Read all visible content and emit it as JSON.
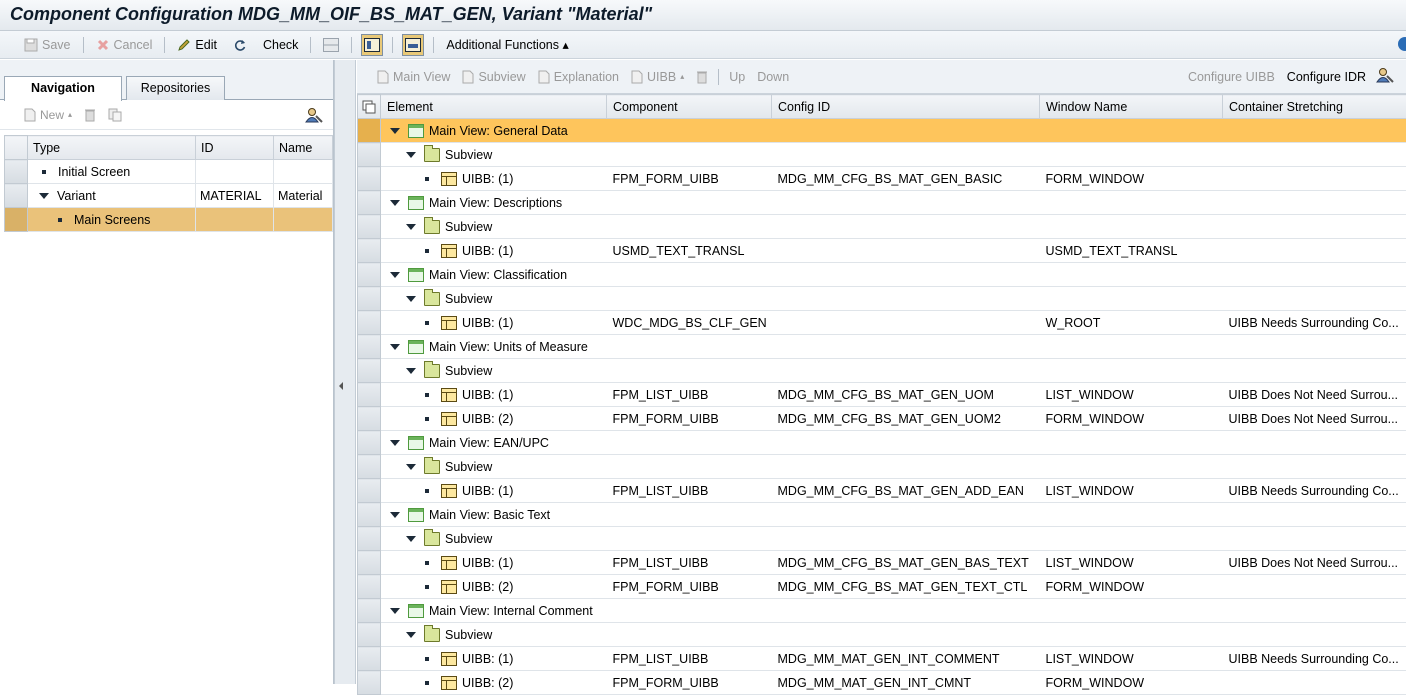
{
  "window": {
    "title": "Component Configuration MDG_MM_OIF_BS_MAT_GEN, Variant \"Material\""
  },
  "toolbar": {
    "save": "Save",
    "cancel": "Cancel",
    "edit": "Edit",
    "check": "Check",
    "additional_functions": "Additional Functions ▴"
  },
  "left": {
    "tabs": [
      "Navigation",
      "Repositories"
    ],
    "new_label": "New",
    "columns": [
      "Type",
      "ID",
      "Name"
    ],
    "rows": [
      {
        "type": "Initial Screen",
        "id": "",
        "name": ""
      },
      {
        "type": "Variant",
        "id": "MATERIAL",
        "name": "Material"
      },
      {
        "type": "Main Screens",
        "id": "",
        "name": ""
      }
    ]
  },
  "right": {
    "toolbar": {
      "main_view": "Main View",
      "subview": "Subview",
      "explanation": "Explanation",
      "uibb": "UIBB",
      "up": "Up",
      "down": "Down",
      "configure_uibb": "Configure UIBB",
      "configure_idr": "Configure IDR"
    },
    "columns": [
      "Element",
      "Component",
      "Config ID",
      "Window Name",
      "Container Stretching"
    ],
    "rows": [
      {
        "level": 0,
        "kind": "view",
        "element": "Main View: General Data",
        "component": "",
        "config": "",
        "window": "",
        "stretch": "",
        "highlight": true
      },
      {
        "level": 1,
        "kind": "subview",
        "element": "Subview",
        "component": "",
        "config": "",
        "window": "",
        "stretch": ""
      },
      {
        "level": 2,
        "kind": "uibb",
        "element": "UIBB: (1)",
        "component": "FPM_FORM_UIBB",
        "config": "MDG_MM_CFG_BS_MAT_GEN_BASIC",
        "window": "FORM_WINDOW",
        "stretch": ""
      },
      {
        "level": 0,
        "kind": "view",
        "element": "Main View: Descriptions",
        "component": "",
        "config": "",
        "window": "",
        "stretch": ""
      },
      {
        "level": 1,
        "kind": "subview",
        "element": "Subview",
        "component": "",
        "config": "",
        "window": "",
        "stretch": ""
      },
      {
        "level": 2,
        "kind": "uibb",
        "element": "UIBB: (1)",
        "component": "USMD_TEXT_TRANSL",
        "config": "",
        "window": "USMD_TEXT_TRANSL",
        "stretch": ""
      },
      {
        "level": 0,
        "kind": "view",
        "element": "Main View: Classification",
        "component": "",
        "config": "",
        "window": "",
        "stretch": ""
      },
      {
        "level": 1,
        "kind": "subview",
        "element": "Subview",
        "component": "",
        "config": "",
        "window": "",
        "stretch": ""
      },
      {
        "level": 2,
        "kind": "uibb",
        "element": "UIBB: (1)",
        "component": "WDC_MDG_BS_CLF_GEN",
        "config": "",
        "window": "W_ROOT",
        "stretch": "UIBB Needs Surrounding Co..."
      },
      {
        "level": 0,
        "kind": "view",
        "element": "Main View: Units of Measure",
        "component": "",
        "config": "",
        "window": "",
        "stretch": ""
      },
      {
        "level": 1,
        "kind": "subview",
        "element": "Subview",
        "component": "",
        "config": "",
        "window": "",
        "stretch": ""
      },
      {
        "level": 2,
        "kind": "uibb",
        "element": "UIBB: (1)",
        "component": "FPM_LIST_UIBB",
        "config": "MDG_MM_CFG_BS_MAT_GEN_UOM",
        "window": "LIST_WINDOW",
        "stretch": "UIBB Does Not Need Surrou..."
      },
      {
        "level": 2,
        "kind": "uibb",
        "element": "UIBB: (2)",
        "component": "FPM_FORM_UIBB",
        "config": "MDG_MM_CFG_BS_MAT_GEN_UOM2",
        "window": "FORM_WINDOW",
        "stretch": "UIBB Does Not Need Surrou..."
      },
      {
        "level": 0,
        "kind": "view",
        "element": "Main View: EAN/UPC",
        "component": "",
        "config": "",
        "window": "",
        "stretch": ""
      },
      {
        "level": 1,
        "kind": "subview",
        "element": "Subview",
        "component": "",
        "config": "",
        "window": "",
        "stretch": ""
      },
      {
        "level": 2,
        "kind": "uibb",
        "element": "UIBB: (1)",
        "component": "FPM_LIST_UIBB",
        "config": "MDG_MM_CFG_BS_MAT_GEN_ADD_EAN",
        "window": "LIST_WINDOW",
        "stretch": "UIBB Needs Surrounding Co..."
      },
      {
        "level": 0,
        "kind": "view",
        "element": "Main View: Basic Text",
        "component": "",
        "config": "",
        "window": "",
        "stretch": ""
      },
      {
        "level": 1,
        "kind": "subview",
        "element": "Subview",
        "component": "",
        "config": "",
        "window": "",
        "stretch": ""
      },
      {
        "level": 2,
        "kind": "uibb",
        "element": "UIBB: (1)",
        "component": "FPM_LIST_UIBB",
        "config": "MDG_MM_CFG_BS_MAT_GEN_BAS_TEXT",
        "window": "LIST_WINDOW",
        "stretch": "UIBB Does Not Need Surrou..."
      },
      {
        "level": 2,
        "kind": "uibb",
        "element": "UIBB: (2)",
        "component": "FPM_FORM_UIBB",
        "config": "MDG_MM_CFG_BS_MAT_GEN_TEXT_CTL",
        "window": "FORM_WINDOW",
        "stretch": ""
      },
      {
        "level": 0,
        "kind": "view",
        "element": "Main View: Internal Comment",
        "component": "",
        "config": "",
        "window": "",
        "stretch": ""
      },
      {
        "level": 1,
        "kind": "subview",
        "element": "Subview",
        "component": "",
        "config": "",
        "window": "",
        "stretch": ""
      },
      {
        "level": 2,
        "kind": "uibb",
        "element": "UIBB: (1)",
        "component": "FPM_LIST_UIBB",
        "config": "MDG_MM_MAT_GEN_INT_COMMENT",
        "window": "LIST_WINDOW",
        "stretch": "UIBB Needs Surrounding Co..."
      },
      {
        "level": 2,
        "kind": "uibb",
        "element": "UIBB: (2)",
        "component": "FPM_FORM_UIBB",
        "config": "MDG_MM_MAT_GEN_INT_CMNT",
        "window": "FORM_WINDOW",
        "stretch": ""
      }
    ]
  },
  "colors": {
    "highlight_row": "#fec55c",
    "selected_nav_row": "#eac27a",
    "title_text": "#0d1b2a"
  }
}
